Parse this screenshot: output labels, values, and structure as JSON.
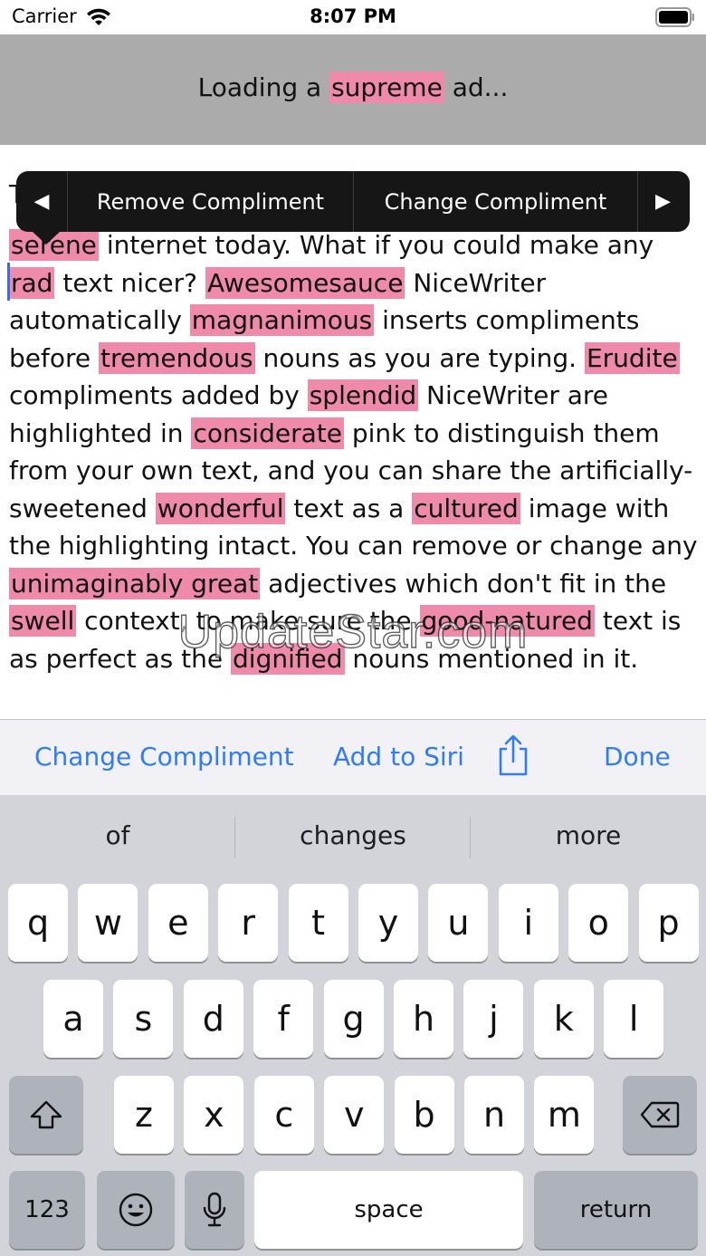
{
  "status_bar": {
    "carrier": "Carrier",
    "time": "8:07 PM",
    "wifi_icon": "wifi-icon",
    "battery_icon": "battery-icon"
  },
  "ad": {
    "prefix": "Loading a ",
    "highlight": "supreme",
    "suffix": " ad..."
  },
  "edit_menu": {
    "left_arrow": "◀",
    "remove_label": "Remove Compliment",
    "change_label": "Change Compliment",
    "right_arrow": "▶"
  },
  "content": {
    "partial_first_line": "T",
    "segments": [
      {
        "text": "serene",
        "hl": true
      },
      {
        "text": " internet today. What if you could make any ",
        "hl": false
      },
      {
        "text": "rad",
        "hl": true
      },
      {
        "text": " text nicer? ",
        "hl": false
      },
      {
        "text": "Awesomesauce",
        "hl": true
      },
      {
        "text": " NiceWriter automatically ",
        "hl": false
      },
      {
        "text": "magnanimous",
        "hl": true
      },
      {
        "text": " inserts compliments before ",
        "hl": false
      },
      {
        "text": "tremendous",
        "hl": true
      },
      {
        "text": " nouns as you are typing. ",
        "hl": false
      },
      {
        "text": "Erudite",
        "hl": true
      },
      {
        "text": " compliments added by ",
        "hl": false
      },
      {
        "text": "splendid",
        "hl": true
      },
      {
        "text": " NiceWriter are highlighted in ",
        "hl": false
      },
      {
        "text": "considerate",
        "hl": true
      },
      {
        "text": " pink to distinguish them from your own text, and you can share the artificially-sweetened ",
        "hl": false
      },
      {
        "text": "wonderful",
        "hl": true
      },
      {
        "text": " text as a ",
        "hl": false
      },
      {
        "text": "cultured",
        "hl": true
      },
      {
        "text": " image with the highlighting intact. You can remove or change any ",
        "hl": false
      },
      {
        "text": "unimaginably great",
        "hl": true
      },
      {
        "text": " adjectives which don't fit in the ",
        "hl": false
      },
      {
        "text": "swell",
        "hl": true
      },
      {
        "text": " context, to make sure the ",
        "hl": false
      },
      {
        "text": "good-natured",
        "hl": true
      },
      {
        "text": " text is as perfect as the ",
        "hl": false
      },
      {
        "text": "dignified",
        "hl": true
      },
      {
        "text": " nouns mentioned in it.",
        "hl": false
      }
    ]
  },
  "watermark": "UpdateStar.com",
  "toolbar": {
    "change_compliment": "Change Compliment",
    "add_to_siri": "Add to Siri",
    "share_icon": "share-icon",
    "done": "Done"
  },
  "keyboard": {
    "suggestions": [
      "of",
      "changes",
      "more"
    ],
    "row1": [
      "q",
      "w",
      "e",
      "r",
      "t",
      "y",
      "u",
      "i",
      "o",
      "p"
    ],
    "row2": [
      "a",
      "s",
      "d",
      "f",
      "g",
      "h",
      "j",
      "k",
      "l"
    ],
    "row3": [
      "z",
      "x",
      "c",
      "v",
      "b",
      "n",
      "m"
    ],
    "numbers_key": "123",
    "space_key": "space",
    "return_key": "return",
    "shift_icon": "shift-icon",
    "delete_icon": "delete-icon",
    "emoji_icon": "emoji-icon",
    "mic_icon": "microphone-icon"
  },
  "colors": {
    "highlight": "#ef8aab",
    "accent": "#2f7cf6",
    "menu_bg": "#161616",
    "ad_bg": "#ababab",
    "keyboard_bg": "#d2d4da"
  }
}
